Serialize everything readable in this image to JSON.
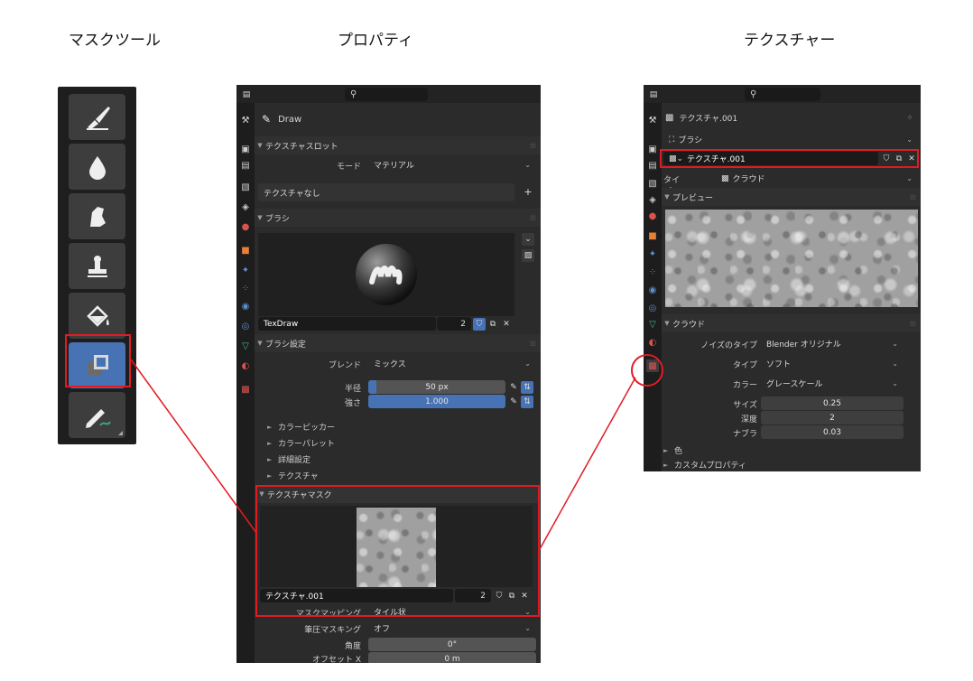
{
  "captions": {
    "mask_tool": "マスクツール",
    "properties": "プロパティ",
    "texture": "テクスチャー"
  },
  "colors": {
    "accent": "#4772b3",
    "highlight": "#e21b23",
    "panel_bg": "#2b2b2b"
  },
  "toolbar": {
    "tools": [
      {
        "name": "draw-brush-icon"
      },
      {
        "name": "soften-drop-icon"
      },
      {
        "name": "smear-icon"
      },
      {
        "name": "clone-stamp-icon"
      },
      {
        "name": "fill-bucket-icon"
      },
      {
        "name": "mask-icon",
        "active": true
      },
      {
        "name": "annotate-icon"
      }
    ]
  },
  "properties": {
    "tool_name": "Draw",
    "texture_slot": {
      "header": "テクスチャスロット",
      "mode_label": "モード",
      "mode_value": "マテリアル",
      "texture_value": "テクスチャなし"
    },
    "brush": {
      "header": "ブラシ",
      "name": "TexDraw",
      "users": "2"
    },
    "brush_settings": {
      "header": "ブラシ設定",
      "blend_label": "ブレンド",
      "blend_value": "ミックス",
      "radius_label": "半径",
      "radius_value": "50 px",
      "strength_label": "強さ",
      "strength_value": "1.000",
      "radius_fill": 0.06,
      "strength_fill": 1.0,
      "subpanels": [
        "カラーピッカー",
        "カラーパレット",
        "詳細設定",
        "テクスチャ"
      ]
    },
    "texture_mask": {
      "header": "テクスチャマスク",
      "texture_name": "テクスチャ.001",
      "users": "2",
      "mapping_label": "マスクマッピング",
      "mapping_value": "タイル状",
      "pressure_label": "筆圧マスキング",
      "pressure_value": "オフ",
      "angle_label": "角度",
      "angle_value": "0°",
      "offset_label": "オフセット X",
      "offset_value": "0 m"
    }
  },
  "texture_panel": {
    "title": "テクスチャ.001",
    "context_brush": "ブラシ",
    "datablock_name": "テクスチャ.001",
    "type_label": "タイプ",
    "type_value": "クラウド",
    "preview_header": "プレビュー",
    "clouds_header": "クラウド",
    "noise_type_label": "ノイズのタイプ",
    "noise_type_value": "Blender オリジナル",
    "type2_label": "タイプ",
    "type2_value": "ソフト",
    "color_label": "カラー",
    "color_value": "グレースケール",
    "size_label": "サイズ",
    "size_value": "0.25",
    "depth_label": "深度",
    "depth_value": "2",
    "nabla_label": "ナブラ",
    "nabla_value": "0.03",
    "color_panel": "色",
    "custom_props": "カスタムプロパティ"
  }
}
